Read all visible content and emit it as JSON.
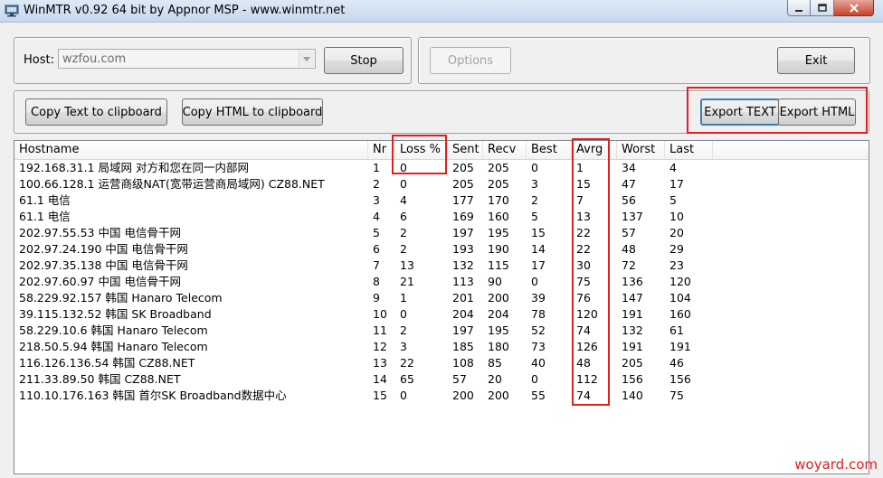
{
  "window": {
    "title": "WinMTR v0.92 64 bit by Appnor MSP - www.winmtr.net",
    "icon": "network-app-icon"
  },
  "toolbar": {
    "host_label": "Host:",
    "host_value": "wzfou.com",
    "stop_label": "Stop",
    "options_label": "Options",
    "exit_label": "Exit",
    "copy_text_label": "Copy Text to clipboard",
    "copy_html_label": "Copy HTML to clipboard",
    "export_text_label": "Export TEXT",
    "export_html_label": "Export HTML"
  },
  "table": {
    "columns": [
      "Hostname",
      "Nr",
      "Loss %",
      "Sent",
      "Recv",
      "Best",
      "Avrg",
      "Worst",
      "Last"
    ],
    "rows": [
      [
        "192.168.31.1 局域网 对方和您在同一内部网",
        "1",
        "0",
        "205",
        "205",
        "0",
        "1",
        "34",
        "4"
      ],
      [
        "100.66.128.1 运营商级NAT(宽带运营商局域网)  CZ88.NET",
        "2",
        "0",
        "205",
        "205",
        "3",
        "15",
        "47",
        "17"
      ],
      [
        "61.1                        电信",
        "3",
        "4",
        "177",
        "170",
        "2",
        "7",
        "56",
        "5"
      ],
      [
        "61.1                        电信",
        "4",
        "6",
        "169",
        "160",
        "5",
        "13",
        "137",
        "10"
      ],
      [
        "202.97.55.53 中国 电信骨干网",
        "5",
        "2",
        "197",
        "195",
        "15",
        "22",
        "57",
        "20"
      ],
      [
        "202.97.24.190 中国 电信骨干网",
        "6",
        "2",
        "193",
        "190",
        "14",
        "22",
        "48",
        "29"
      ],
      [
        "202.97.35.138 中国 电信骨干网",
        "7",
        "13",
        "132",
        "115",
        "17",
        "30",
        "72",
        "23"
      ],
      [
        "202.97.60.97 中国 电信骨干网",
        "8",
        "21",
        "113",
        "90",
        "0",
        "75",
        "136",
        "120"
      ],
      [
        "58.229.92.157 韩国 Hanaro Telecom",
        "9",
        "1",
        "201",
        "200",
        "39",
        "76",
        "147",
        "104"
      ],
      [
        "39.115.132.52 韩国 SK Broadband",
        "10",
        "0",
        "204",
        "204",
        "78",
        "120",
        "191",
        "160"
      ],
      [
        "58.229.10.6 韩国 Hanaro Telecom",
        "11",
        "2",
        "197",
        "195",
        "52",
        "74",
        "132",
        "61"
      ],
      [
        "218.50.5.94 韩国 Hanaro Telecom",
        "12",
        "3",
        "185",
        "180",
        "73",
        "126",
        "191",
        "191"
      ],
      [
        "116.126.136.54 韩国  CZ88.NET",
        "13",
        "22",
        "108",
        "85",
        "40",
        "48",
        "205",
        "46"
      ],
      [
        "211.33.89.50 韩国  CZ88.NET",
        "14",
        "65",
        "57",
        "20",
        "0",
        "112",
        "156",
        "156"
      ],
      [
        "110.10.176.163 韩国 首尔SK Broadband数据中心",
        "15",
        "0",
        "200",
        "200",
        "55",
        "74",
        "140",
        "75"
      ]
    ]
  },
  "watermark": "woyard.com",
  "colors": {
    "highlight": "#e02020",
    "titlebar": "#dfe9f5",
    "window_bg": "#f0f0f0"
  }
}
